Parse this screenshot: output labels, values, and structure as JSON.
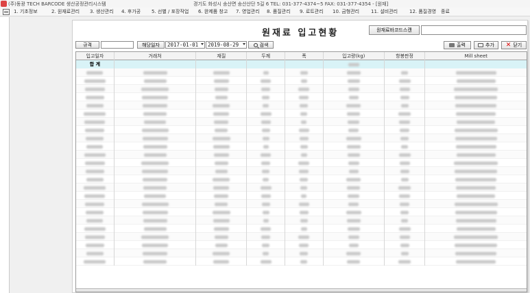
{
  "titlebar": {
    "app_title": "(주)동광 TECH  BARCODE 생산공정관리시스템",
    "company_info": "경기도 화성시 송산면 송산산단 5길 6    TEL: 031-377-4374~5   FAX: 031-377-4354        - [원재]"
  },
  "menu": [
    "1. 기초정보",
    "2. 원재료관리",
    "3. 생산관리",
    "4. 후가공",
    "5. 선별 / 포장작업",
    "6. 완제품 창고",
    "7. 영업관리",
    "8. 품질관리",
    "9. 로트관리",
    "10. 금형관리",
    "11. 설비관리",
    "12. 품질경영",
    "종료"
  ],
  "page": {
    "title": "원재료 입고현황"
  },
  "toolbar": {
    "barcode_scan_label": "원재료바코드스캔",
    "barcode_value": "",
    "spec_label": "규격",
    "spec_value": "",
    "date_label": "해당일자",
    "date_from": "2017-01-01",
    "date_to": "2019-08-29",
    "search_label": "검색",
    "print_label": "출력",
    "add_label": "추가",
    "close_label": "닫기"
  },
  "table": {
    "columns": [
      "입고일자",
      "거래처",
      "재질",
      "두께",
      "폭",
      "입고량(kg)",
      "항봉판정",
      "Mill sheet"
    ],
    "total_label": "합 계",
    "blurred_widths": [
      28,
      36,
      22,
      12,
      12,
      18,
      14,
      60
    ],
    "row_count": 24
  },
  "colors": {
    "total_row": "#d9f3f7",
    "close_icon": "#dd0000"
  }
}
